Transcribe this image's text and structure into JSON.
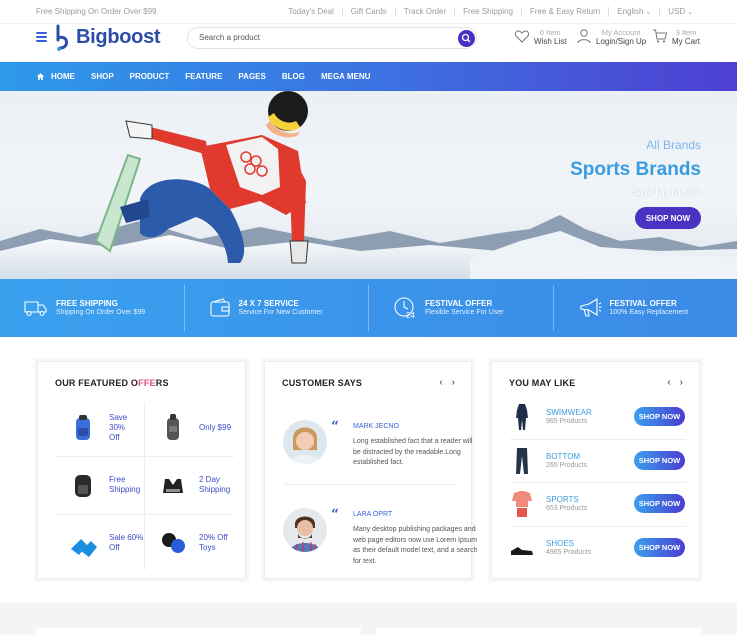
{
  "topbar": {
    "promo": "Free Shipping On Order Over $99",
    "links": [
      "Today's Deal",
      "Gift Cards",
      "Track Order",
      "Free Shipping",
      "Free & Easy Return"
    ],
    "language": "English",
    "currency": "USD"
  },
  "header": {
    "logo": "Bigboost",
    "search_placeholder": "Search a product",
    "wishlist": {
      "count": "0 Item",
      "label": "Wish List"
    },
    "account": {
      "top": "My Account",
      "label": "Login/Sign Up"
    },
    "cart": {
      "count": "3 Item",
      "label": "My Cart"
    }
  },
  "nav": {
    "items": [
      "HOME",
      "SHOP",
      "PRODUCT",
      "FEATURE",
      "PAGES",
      "BLOG",
      "MEGA MENU"
    ]
  },
  "hero": {
    "kicker": "All Brands",
    "title": "Sports Brands",
    "subtitle": "Save Up To 50%",
    "button": "SHOP NOW"
  },
  "features": [
    {
      "title": "FREE SHIPPING",
      "sub": "Shipping On Order Over $99",
      "icon": "truck-icon"
    },
    {
      "title": "24 X 7 SERVICE",
      "sub": "Service For New Customer",
      "icon": "wallet-icon"
    },
    {
      "title": "FESTIVAL OFFER",
      "sub": "Flexible Service For User",
      "icon": "clock-24-icon"
    },
    {
      "title": "FESTIVAL OFFER",
      "sub": "100% Easy Replacement",
      "icon": "megaphone-icon"
    }
  ],
  "featured": {
    "title_a": "OUR FEATURED O",
    "title_b": "FFE",
    "title_c": "RS",
    "offers": [
      {
        "line1": "Save 30%",
        "line2": "Off"
      },
      {
        "line1": "Only $99",
        "line2": ""
      },
      {
        "line1": "Free",
        "line2": "Shipping"
      },
      {
        "line1": "2 Day",
        "line2": "Shipping"
      },
      {
        "line1": "Sale 60%",
        "line2": "Off"
      },
      {
        "line1": "20% Off",
        "line2": "Toys"
      }
    ]
  },
  "customer_says": {
    "title": "CUSTOMER SAYS",
    "reviews": [
      {
        "name": "MARK JECNO",
        "text": "Long established fact that a reader will be distracted by the readable.Long established fact."
      },
      {
        "name": "LARA OPRT",
        "text": "Many desktop publishing packages and web page editors now use Lorem Ipsum as their default model text, and a search for text."
      }
    ]
  },
  "you_may_like": {
    "title": "YOU MAY LIKE",
    "items": [
      {
        "name": "SWIMWEAR",
        "count": "965 Products",
        "button": "SHOP NOW"
      },
      {
        "name": "BOTTOM",
        "count": "265 Products",
        "button": "SHOP NOW"
      },
      {
        "name": "SPORTS",
        "count": "653 Products",
        "button": "SHOP NOW"
      },
      {
        "name": "SHOES",
        "count": "4965 Products",
        "button": "SHOP NOW"
      }
    ]
  },
  "colors": {
    "brand": "#2d4ca8",
    "accent": "#4a33c2",
    "sky": "#3a9ce0"
  }
}
